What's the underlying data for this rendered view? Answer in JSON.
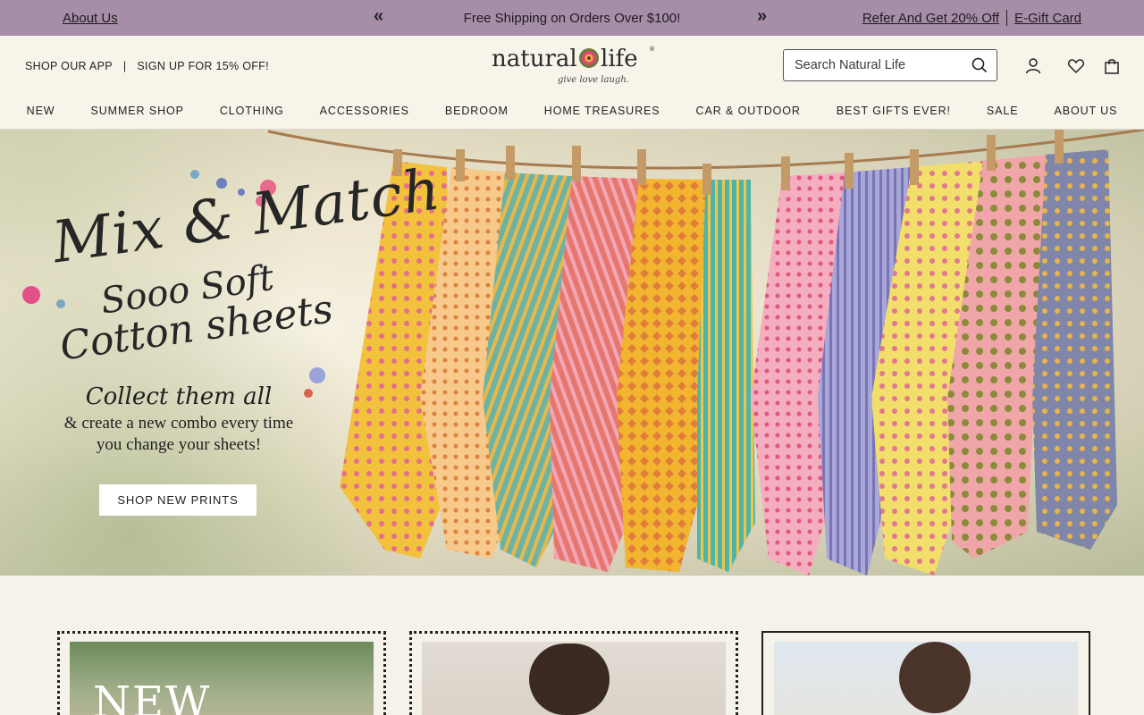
{
  "promo": {
    "about": "About Us",
    "message": "Free Shipping on Orders Over $100!",
    "prev": "«",
    "next": "»",
    "refer": "Refer And Get 20% Off",
    "egift": "E-Gift Card"
  },
  "header": {
    "shop_app": "SHOP OUR APP",
    "divider": "|",
    "signup": "SIGN UP FOR 15% OFF!",
    "logo_text": "natural life",
    "logo_tagline": "give love laugh",
    "search_placeholder": "Search Natural Life"
  },
  "nav": [
    "NEW",
    "SUMMER SHOP",
    "CLOTHING",
    "ACCESSORIES",
    "BEDROOM",
    "HOME TREASURES",
    "CAR & OUTDOOR",
    "BEST GIFTS EVER!",
    "SALE",
    "ABOUT US"
  ],
  "hero": {
    "line1": "Mix & Match",
    "line2": "Sooo Soft",
    "line3": "Cotton sheets",
    "collect": "Collect them all",
    "sub1": "& create a new combo every time",
    "sub2": "you change your sheets!",
    "cta": "SHOP NEW PRINTS"
  },
  "cards": [
    {
      "label": "NEW"
    },
    {
      "label": ""
    },
    {
      "label": ""
    }
  ],
  "colors": {
    "promo_bg": "#a78ea8",
    "header_bg": "#f7f4ea",
    "accent": "#222222"
  }
}
